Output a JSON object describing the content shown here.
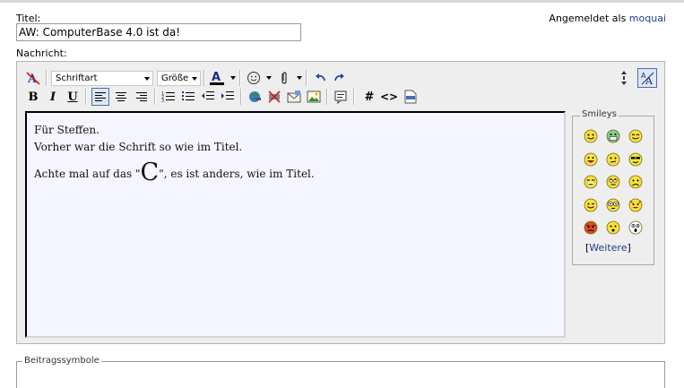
{
  "labels": {
    "title": "Titel:",
    "message": "Nachricht:",
    "logged_in_as": "Angemeldet als",
    "beitragssymbole": "Beitragssymbole"
  },
  "user": {
    "name": "moquai"
  },
  "title_value": "AW: ComputerBase 4.0 ist da!",
  "toolbar": {
    "font_select": "Schriftart",
    "size_select": "Größe"
  },
  "editor_text": {
    "line1": "Für Steffen.",
    "line2": "Vorher war die Schrift so wie im Titel.",
    "line3_pre": "Achte mal auf das \"",
    "line3_big": "C",
    "line3_post": "\", es ist anders, wie im Titel."
  },
  "smileys": {
    "legend": "Smileys",
    "more_open": "[",
    "more_label": "Weitere",
    "more_close": "]",
    "items": [
      "smile-icon",
      "grin-teeth-icon",
      "happy-icon",
      "big-grin-icon",
      "confused-icon",
      "cool-icon",
      "laugh-icon",
      "rolleyes-icon",
      "frown-icon",
      "wink-icon",
      "eek-icon",
      "devil-icon",
      "mad-icon",
      "surprised-icon",
      "shocked-icon"
    ]
  },
  "colors": {
    "link": "#1f3f8f",
    "editor_bg": "#eeeeee",
    "textarea_bg": "#f5f5ff",
    "smiley_yellow": "#f7e23b"
  }
}
